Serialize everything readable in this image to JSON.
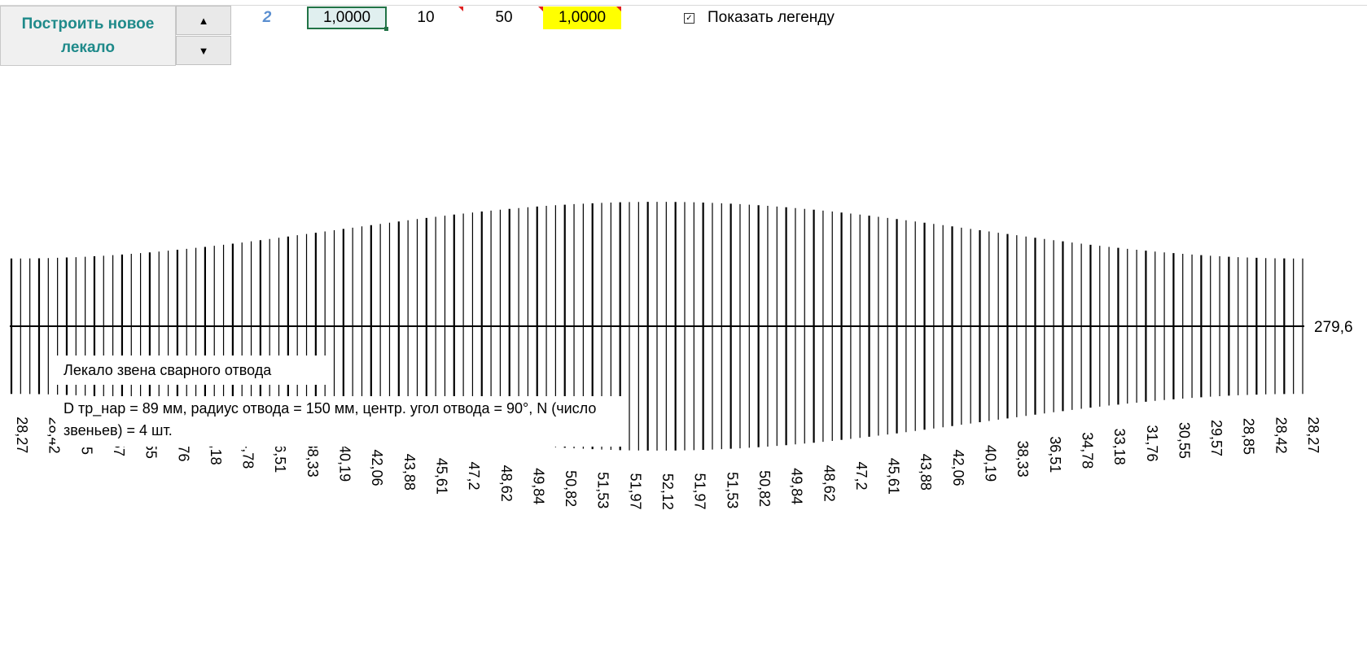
{
  "toolbar": {
    "build_label": "Построить новое\nлекало",
    "spin_up_icon": "triangle-up-icon",
    "spin_down_icon": "triangle-down-icon"
  },
  "cells": {
    "index": "2",
    "scale_value": "1,0000",
    "value_ten": "10",
    "value_fifty": "50",
    "yellow_value": "1,0000",
    "highlight_color": "#ffff00"
  },
  "legend_toggle": {
    "checked": true,
    "label": "Показать легенду"
  },
  "legend": {
    "title": "Лекало звена сварного отвода",
    "description": "D тр_нар = 89  мм, радиус отвода = 150  мм, центр. угол отвода = 90°, N (число звеньев) = 4 шт."
  },
  "chart_data": {
    "type": "bar",
    "total_length_label": "279,6",
    "lines_count": 141,
    "labels": [
      "28,27",
      "28,42",
      "28,85",
      "29,57",
      "30,55",
      "31,76",
      "33,18",
      "34,78",
      "36,51",
      "38,33",
      "40,19",
      "42,06",
      "43,88",
      "45,61",
      "47,2",
      "48,62",
      "49,84",
      "50,82",
      "51,53",
      "51,97",
      "52,12",
      "51,97",
      "51,53",
      "50,82",
      "49,84",
      "48,62",
      "47,2",
      "45,61",
      "43,88",
      "42,06",
      "40,19",
      "38,33",
      "36,51",
      "34,78",
      "33,18",
      "31,76",
      "30,55",
      "29,57",
      "28,85",
      "28,42",
      "28,27"
    ],
    "max_value": 52.12,
    "min_value": 28.27
  }
}
